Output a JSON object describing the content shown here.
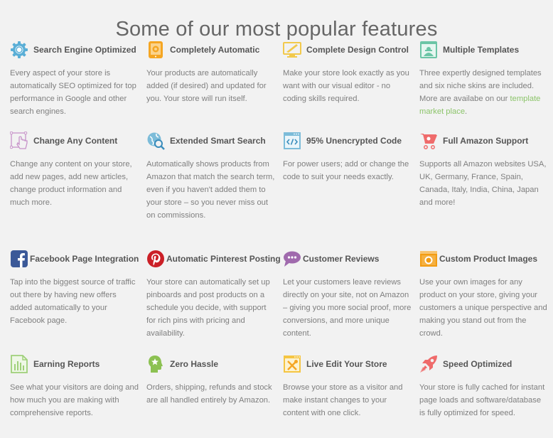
{
  "heading": "Some of our most popular features",
  "colors": {
    "background": "#f2f2f2",
    "link": "#8cc46a"
  },
  "features": [
    {
      "icon": "gear-globe-icon",
      "title": "Search Engine Optimized",
      "desc": "Every aspect of your store is automatically SEO optimized for top performance in Google and other search engines."
    },
    {
      "icon": "tablet-gear-icon",
      "title": "Completely Automatic",
      "desc": "Your products are automatically added (if desired) and updated for you. Your store will run itself."
    },
    {
      "icon": "monitor-brush-icon",
      "title": "Complete Design Control",
      "desc": "Make your store look exactly as you want with our visual editor - no coding skills required."
    },
    {
      "icon": "template-window-icon",
      "title": "Multiple Templates",
      "desc_before": "Three expertly designed templates and six niche skins are included. More are availabe on our ",
      "link": "template market place",
      "desc_after": "."
    },
    {
      "icon": "hand-select-icon",
      "title": "Change Any Content",
      "desc": "Change any content on your store, add new pages, add new articles, change product information and much more."
    },
    {
      "icon": "globe-search-icon",
      "title": "Extended Smart Search",
      "desc": "Automatically shows products from Amazon that match the search term, even if you haven't added them to your store – so you never miss out on commissions."
    },
    {
      "icon": "code-window-icon",
      "title": "95% Unencrypted Code",
      "desc": "For power users; add or change the code to suit your needs exactly."
    },
    {
      "icon": "shopping-cart-icon",
      "title": "Full Amazon Support",
      "desc": "Supports all Amazon websites USA, UK, Germany, France, Spain, Canada, Italy, India, China, Japan and more!"
    },
    {
      "icon": "facebook-icon",
      "title": "Facebook Page Integration",
      "desc": "Tap into the biggest source of traffic out there by having new offers added automatically to your Facebook page."
    },
    {
      "icon": "pinterest-icon",
      "title": "Automatic Pinterest Posting",
      "desc": "Your store can automatically set up pinboards and post products on a schedule you decide, with support for rich pins with pricing and availability."
    },
    {
      "icon": "chat-bubble-icon",
      "title": "Customer Reviews",
      "desc": "Let your customers leave reviews directly on your site, not on Amazon – giving you more social proof, more conversions, and more unique content."
    },
    {
      "icon": "camera-icon",
      "title": "Custom Product Images",
      "desc": "Use your own images for any product on your store, giving your customers a unique perspective and making you stand out from the crowd."
    },
    {
      "icon": "bar-chart-report-icon",
      "title": "Earning Reports",
      "desc": "See what your visitors are doing and how much you are making with comprehensive reports."
    },
    {
      "icon": "head-star-icon",
      "title": "Zero Hassle",
      "desc": "Orders, shipping, refunds and stock are all handled entirely by Amazon."
    },
    {
      "icon": "tools-window-icon",
      "title": "Live Edit Your Store",
      "desc": "Browse your store as a visitor and make instant changes to your content with one click."
    },
    {
      "icon": "rocket-icon",
      "title": "Speed Optimized",
      "desc": "Your store is fully cached for instant page loads and software/database is fully optimized for speed."
    }
  ]
}
